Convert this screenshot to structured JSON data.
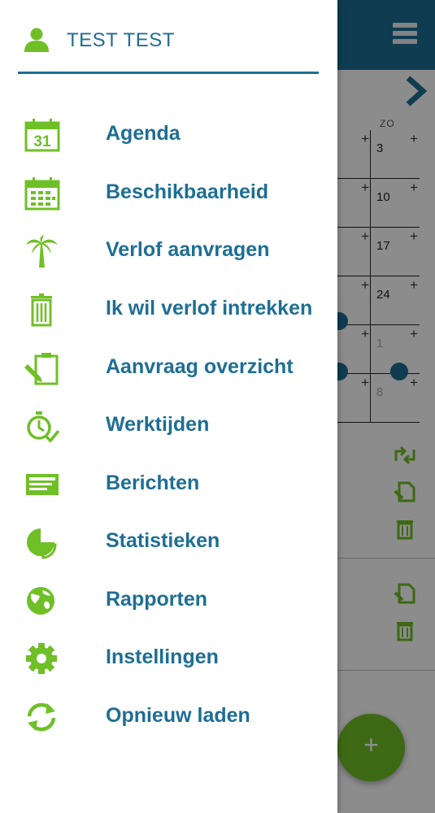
{
  "user": {
    "name": "TEST  TEST",
    "icon": "user-icon"
  },
  "colors": {
    "primary": "#1e6e94",
    "accent": "#6fbf26",
    "scrim": "rgba(0,0,0,0.45)"
  },
  "menu": [
    {
      "label": "Agenda",
      "icon": "calendar-31-icon"
    },
    {
      "label": "Beschikbaarheid",
      "icon": "calendar-grid-icon"
    },
    {
      "label": "Verlof aanvragen",
      "icon": "palm-tree-icon"
    },
    {
      "label": "Ik wil verlof intrekken",
      "icon": "trash-icon"
    },
    {
      "label": "Aanvraag overzicht",
      "icon": "clipboard-pen-icon"
    },
    {
      "label": "Werktijden",
      "icon": "stopwatch-check-icon"
    },
    {
      "label": "Berichten",
      "icon": "messages-icon"
    },
    {
      "label": "Statistieken",
      "icon": "pie-chart-icon"
    },
    {
      "label": "Rapporten",
      "icon": "globe-icon"
    },
    {
      "label": "Instellingen",
      "icon": "gear-icon"
    },
    {
      "label": "Opnieuw laden",
      "icon": "refresh-icon"
    }
  ],
  "background": {
    "weekday": "ZO",
    "days": [
      "3",
      "10",
      "17",
      "24",
      "1",
      "8"
    ],
    "fab_label": "+"
  }
}
